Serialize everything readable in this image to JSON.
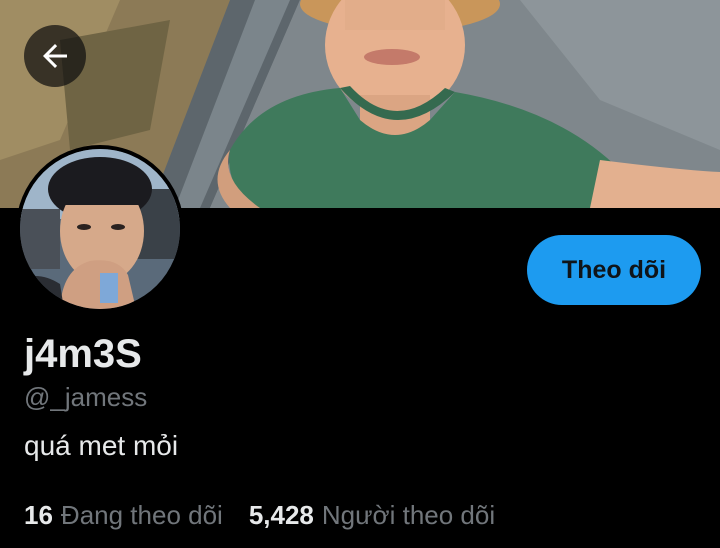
{
  "profile": {
    "display_name": "j4m3S",
    "handle": "@_jamess",
    "bio": "quá met mỏi"
  },
  "actions": {
    "follow_label": "Theo dõi"
  },
  "stats": {
    "following_count": "16",
    "following_label": "Đang theo dõi",
    "followers_count": "5,428",
    "followers_label": "Người theo dõi"
  },
  "icons": {
    "back": "arrow-left-icon"
  },
  "colors": {
    "background": "#000000",
    "accent": "#1d9bf0",
    "primary_text": "#e7e9ea",
    "secondary_text": "#71767b"
  }
}
